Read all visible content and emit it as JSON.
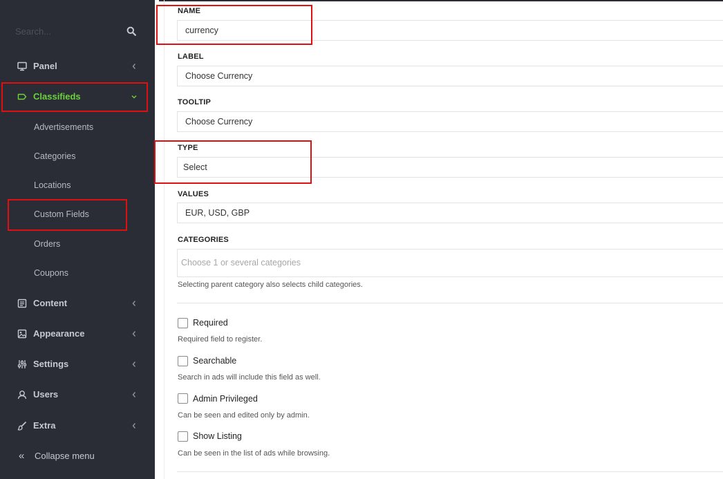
{
  "sidebar": {
    "search_placeholder": "Search...",
    "nav": {
      "panel": "Panel",
      "classifieds": "Classifieds",
      "content": "Content",
      "appearance": "Appearance",
      "settings": "Settings",
      "users": "Users",
      "extra": "Extra"
    },
    "classifieds_sub": {
      "advertisements": "Advertisements",
      "categories": "Categories",
      "locations": "Locations",
      "custom_fields": "Custom Fields",
      "orders": "Orders",
      "coupons": "Coupons"
    },
    "collapse_glyph": "«",
    "collapse_label": "Collapse menu"
  },
  "form": {
    "name": {
      "label": "NAME",
      "value": "currency"
    },
    "label": {
      "label": "LABEL",
      "value": "Choose Currency"
    },
    "tooltip": {
      "label": "TOOLTIP",
      "value": "Choose Currency"
    },
    "type": {
      "label": "TYPE",
      "value": "Select"
    },
    "values": {
      "label": "VALUES",
      "value": "EUR, USD, GBP"
    },
    "categories": {
      "label": "CATEGORIES",
      "placeholder": "Choose 1 or several categories",
      "help": "Selecting parent category also selects child categories."
    },
    "options": {
      "required": {
        "label": "Required",
        "help": "Required field to register.",
        "checked": false
      },
      "searchable": {
        "label": "Searchable",
        "help": "Search in ads will include this field as well.",
        "checked": false
      },
      "admin_privileged": {
        "label": "Admin Privileged",
        "help": "Can be seen and edited only by admin.",
        "checked": false
      },
      "show_listing": {
        "label": "Show Listing",
        "help": "Can be seen in the list of ads while browsing.",
        "checked": false
      }
    }
  },
  "colors": {
    "sidebar_bg": "#2a2d36",
    "active_accent": "#6bd23a",
    "highlight_box": "#e01010"
  },
  "icons": {
    "search": "search-icon",
    "panel": "monitor-icon",
    "classifieds": "tag-icon",
    "content": "document-icon",
    "appearance": "image-icon",
    "settings": "sliders-icon",
    "users": "user-icon",
    "extra": "brush-icon",
    "collapse": "double-chevron-left-icon"
  }
}
